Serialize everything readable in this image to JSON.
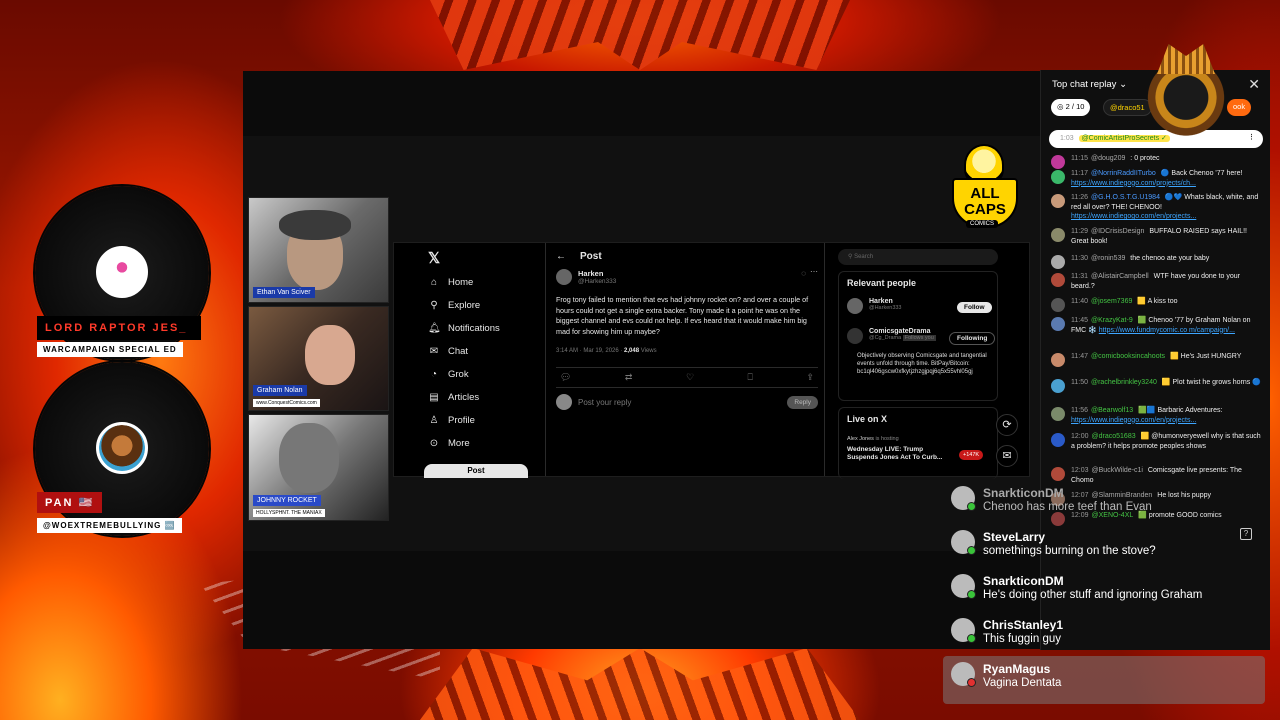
{
  "hosts": [
    {
      "name": "LORD RAPTOR JES_",
      "tag": "WARCAMPAIGN SPECIAL ED"
    },
    {
      "name": "PAN 🇺🇸",
      "tag": "@WOEXTREMEBULLYING 🆒"
    }
  ],
  "tiles": [
    {
      "label": "Ethan Van Sciver",
      "sub": ""
    },
    {
      "label": "Graham Nolan",
      "sub": "www.ConquestComics.com"
    },
    {
      "label": "JOHNNY ROCKET",
      "sub": "HOLLYSPHNT. THE MANIAX"
    }
  ],
  "x": {
    "logo": "𝕏",
    "nav": [
      "Home",
      "Explore",
      "Notifications",
      "Chat",
      "Grok",
      "Articles",
      "Profile",
      "More"
    ],
    "post_button": "Post",
    "header": "Post",
    "author_name": "Harken",
    "author_handle": "@Harken333",
    "tweet_text": "Frog tony failed to mention that evs had johnny rocket on? and over a couple of hours could not get a single extra backer. Tony made it a point he was on the biggest channel and evs could not help. If evs heard that it would make him big mad for showing him up maybe?",
    "tweet_time": "3:14 AM · Mar 19, 2026 ·",
    "tweet_views": "2,048",
    "tweet_views_label": "Views",
    "reply_placeholder": "Post your reply",
    "reply_button": "Reply",
    "search_placeholder": "Search",
    "relevant_title": "Relevant people",
    "person1_name": "Harken",
    "person1_handle": "@Harken333",
    "follow_label": "Follow",
    "person2_name": "ComicsgateDrama",
    "person2_handle": "@Cg_Drama",
    "person2_badge": "Follows you",
    "following_label": "Following",
    "person2_desc": "Objectively observing Comicsgate and tangential events unfold through time. BitPay/Bitcoin: bc1ql406gscw0xfkytjzhzgjpqj6q5x55vhl05gj",
    "live_title": "Live on X",
    "live_host": "Alex Jones",
    "live_host_status": "is hosting",
    "live_headline": "Wednesday LIVE: Trump Suspends Jones Act To Curb...",
    "live_count": "+147K"
  },
  "logo": {
    "line1": "ALL",
    "line2": "CAPS",
    "comics": "COMICS"
  },
  "chat": {
    "header": "Top chat replay ⌄",
    "close": "✕",
    "chip1": "2 / 10",
    "chip2": "@draco51",
    "chip3": "ook",
    "pinned_user": "@ComicArtistProSecrets ✓",
    "pinned_time": "1:03",
    "messages": [
      {
        "time": "11:15",
        "user": "@doug209",
        "text": ": 0 protec",
        "color": "#c0399a"
      },
      {
        "time": "11:17",
        "user": "@NorrinRaddIITurbo",
        "text": "🔵 Back Chenoo '77 here!",
        "link": "https://www.indiegogo.com/projects/ch...",
        "color": "#3ab86a"
      },
      {
        "time": "11:26",
        "user": "@G.H.O.S.T.G.U1984",
        "text": "🔵💙 Whats black, white, and red all over? THE! CHENOO!",
        "link": "https://www.indiegogo.com/en/projects...",
        "color": "#c89a7a"
      },
      {
        "time": "11:29",
        "user": "@IDCrisisDesign",
        "text": "BUFFALO RAISED says HAIL!! Great book!",
        "color": "#8a8a6a"
      },
      {
        "time": "11:30",
        "user": "@ronin539",
        "text": "the chenoo ate your baby",
        "color": "#aaa"
      },
      {
        "time": "11:31",
        "user": "@AlistairCampbell",
        "text": "WTF have you done to your beard.?",
        "color": "#b04a3a"
      },
      {
        "time": "11:40",
        "user": "@josem7369",
        "text": "🟨 A kiss too",
        "color": "#555"
      },
      {
        "time": "11:45",
        "user": "@KrazyKat-9",
        "text": "🟩 Chenoo '77 by Graham Nolan on FMC ❄️",
        "link": "https://www.fundmycomic.co m/campaign/...",
        "color": "#5a7ab0"
      },
      {
        "time": "11:47",
        "user": "@comicbooksincahoots",
        "text": "🟨 He's Just HUNGRY",
        "color": "#c88a6a"
      },
      {
        "time": "11:50",
        "user": "@rachelbrinkley3240",
        "text": "🟨 Plot twist he grows horns 🔵",
        "color": "#4aa0d0"
      },
      {
        "time": "11:56",
        "user": "@Bearwolf13",
        "text": "🟩🟦 Barbaric Adventures:",
        "link": "https://www.indiegogo.com/en/projects...",
        "color": "#7a8a6a"
      },
      {
        "time": "12:00",
        "user": "@draco51683",
        "text": "🟨 @humonveryewell why is that such a problem? it helps promote peoples shows",
        "color": "#2a5ac8"
      },
      {
        "time": "12:03",
        "user": "@BuckWilde-c1i",
        "text": "Comicsgate live presents: The Chomo",
        "color": "#b04a3a"
      },
      {
        "time": "12:07",
        "user": "@SlamminBranden",
        "text": "He lost his puppy",
        "color": "#8a6a5a"
      },
      {
        "time": "12:09",
        "user": "@XENO-4XL",
        "text": "🟩 promote GOOD comics",
        "color": "#8a3a3a"
      }
    ]
  },
  "overlay": [
    {
      "name": "SnarkticonDM",
      "text": "Chenoo has more teef than Evan",
      "dim": true
    },
    {
      "name": "SteveLarry",
      "text": "somethings burning on the stove?",
      "dim": false
    },
    {
      "name": "SnarkticonDM",
      "text": "He's doing other stuff and ignoring Graham",
      "dim": false
    },
    {
      "name": "ChrisStanley1",
      "text": "This fuggin guy",
      "dim": false
    },
    {
      "name": "RyanMagus",
      "text": "Vagina Dentata",
      "dim": false
    }
  ]
}
